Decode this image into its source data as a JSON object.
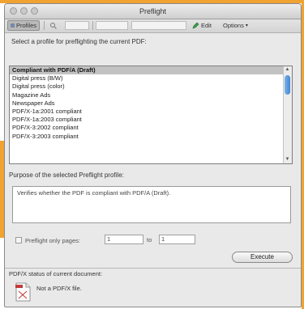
{
  "window": {
    "title": "Preflight"
  },
  "toolbar": {
    "profiles_label": "Profiles",
    "edit_label": "Edit",
    "options_label": "Options"
  },
  "prompt": "Select a profile for preflighting the current PDF:",
  "profiles": {
    "items": [
      "Compliant with PDF/A (Draft)",
      "Digital press (B/W)",
      "Digital press (color)",
      "Magazine Ads",
      "Newspaper Ads",
      "PDF/X-1a:2001 compliant",
      "PDF/X-1a:2003 compliant",
      "PDF/X-3:2002 compliant",
      "PDF/X-3:2003 compliant"
    ],
    "selected_index": 0
  },
  "purpose": {
    "label": "Purpose of the selected Preflight profile:",
    "description": "Verifies whether the PDF is compliant with PDF/A (Draft)."
  },
  "page_range": {
    "label": "Preflight only pages:",
    "from": "1",
    "to_label": "to",
    "to": "1"
  },
  "execute_label": "Execute",
  "status": {
    "label": "PDF/X status of current document:",
    "value": "Not a PDF/X file."
  },
  "colors": {
    "accent_orange": "#f0a330",
    "selection_gray": "#c2c2c2",
    "scroll_thumb_blue": "#3f86d4"
  }
}
